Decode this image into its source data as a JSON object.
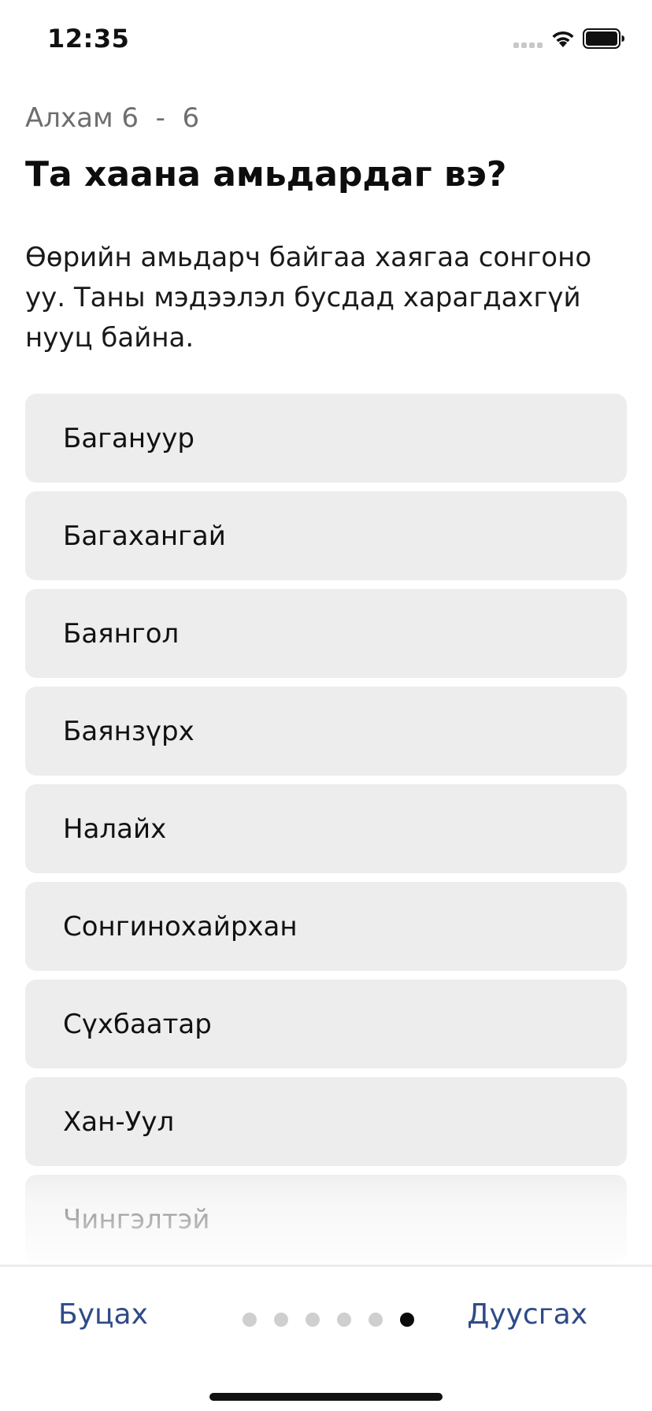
{
  "status_bar": {
    "time": "12:35"
  },
  "header": {
    "step_label": "Алхам 6  -  6",
    "title": "Та хаана амьдардаг вэ?",
    "description": "Өөрийн амьдарч байгаа хаягаа сонгоно уу. Таны мэдээлэл бусдад харагдахгүй нууц байна."
  },
  "options": [
    "Багануур",
    "Багахангай",
    "Баянгол",
    "Баянзүрх",
    "Налайх",
    "Сонгинохайрхан",
    "Сүхбаатар",
    "Хан-Уул",
    "Чингэлтэй"
  ],
  "footer": {
    "back_label": "Буцах",
    "finish_label": "Дуусгах",
    "pager": {
      "total": 6,
      "current": 6
    }
  },
  "colors": {
    "accent": "#2f4b87",
    "option_bg": "#ededed",
    "step_label": "#6e6e6e"
  },
  "icons": [
    "signal-icon",
    "wifi-icon",
    "battery-icon"
  ]
}
